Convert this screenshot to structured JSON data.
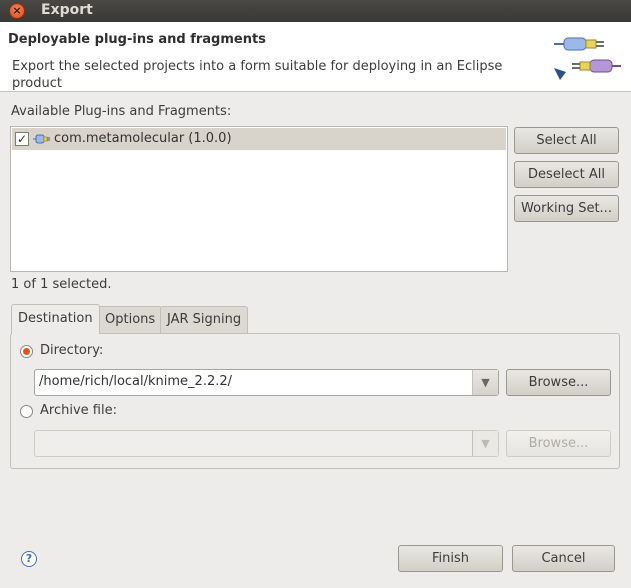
{
  "window": {
    "title": "Export"
  },
  "banner": {
    "title": "Deployable plug-ins and fragments",
    "description": "Export the selected projects into a form suitable for deploying in an Eclipse product",
    "icon": "plug-in-export-wizard-icon"
  },
  "available": {
    "label": "Available Plug-ins and Fragments:",
    "items": [
      {
        "label": "com.metamolecular (1.0.0)",
        "checked": true
      }
    ],
    "selected_text": "1 of 1 selected."
  },
  "side_buttons": {
    "select_all": "Select All",
    "deselect_all": "Deselect All",
    "working_set": "Working Set..."
  },
  "tabs": {
    "destination": "Destination",
    "options": "Options",
    "jar_signing": "JAR Signing",
    "active": "Destination"
  },
  "destination": {
    "directory_label": "Directory:",
    "directory_value": "/home/rich/local/knime_2.2.2/",
    "directory_selected": true,
    "browse_label": "Browse...",
    "archive_label": "Archive file:",
    "archive_value": "",
    "archive_browse_label": "Browse..."
  },
  "footer": {
    "finish": "Finish",
    "cancel": "Cancel"
  },
  "colors": {
    "titlebar": "#3a3935",
    "close": "#d9481b",
    "radio_on": "#e2521f"
  }
}
